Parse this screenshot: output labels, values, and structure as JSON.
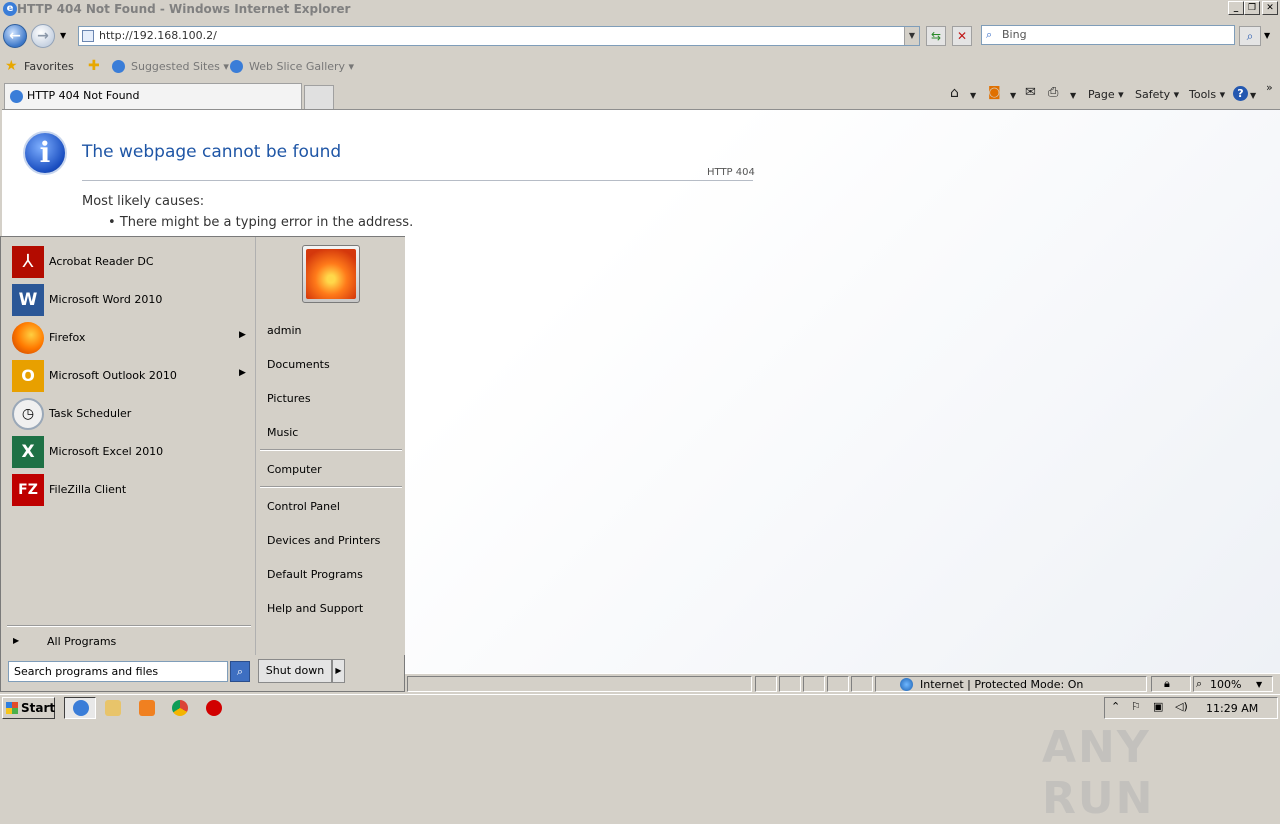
{
  "window": {
    "title": "HTTP 404 Not Found - Windows Internet Explorer",
    "minimize": "_",
    "restore": "❐",
    "close": "✕"
  },
  "nav": {
    "address": "http://192.168.100.2/",
    "search_placeholder": "Bing"
  },
  "favorites": {
    "label": "Favorites",
    "suggested": "Suggested Sites ▾",
    "webslice": "Web Slice Gallery ▾"
  },
  "tab": {
    "label": "HTTP 404 Not Found"
  },
  "commands": {
    "page": "Page ▾",
    "safety": "Safety ▾",
    "tools": "Tools ▾"
  },
  "page": {
    "title": "The webpage cannot be found",
    "code": "HTTP 404",
    "causes_heading": "Most likely causes:",
    "bullet1": "There might be a typing error in the address."
  },
  "start_menu": {
    "programs": [
      {
        "label": "Acrobat Reader DC",
        "icon": "acrobat-icon",
        "color": "#b30b00"
      },
      {
        "label": "Microsoft Word 2010",
        "icon": "word-icon",
        "color": "#2b5797"
      },
      {
        "label": "Firefox",
        "icon": "firefox-icon",
        "color": "#ff7a00",
        "submenu": true
      },
      {
        "label": "Microsoft Outlook 2010",
        "icon": "outlook-icon",
        "color": "#e8a000",
        "submenu": true
      },
      {
        "label": "Task Scheduler",
        "icon": "clock-icon",
        "color": "#9aa8b8"
      },
      {
        "label": "Microsoft Excel 2010",
        "icon": "excel-icon",
        "color": "#1e7145"
      },
      {
        "label": "FileZilla Client",
        "icon": "filezilla-icon",
        "color": "#bf0000"
      }
    ],
    "all_programs": "All Programs",
    "search_placeholder": "Search programs and files",
    "shutdown": "Shut down",
    "right": {
      "user": "admin",
      "documents": "Documents",
      "pictures": "Pictures",
      "music": "Music",
      "computer": "Computer",
      "control_panel": "Control Panel",
      "devices": "Devices and Printers",
      "default_programs": "Default Programs",
      "help": "Help and Support"
    }
  },
  "status": {
    "zone": "Internet | Protected Mode: On",
    "zoom": "100%"
  },
  "taskbar": {
    "start": "Start",
    "clock": "11:29 AM"
  },
  "watermark": "ANY RUN"
}
